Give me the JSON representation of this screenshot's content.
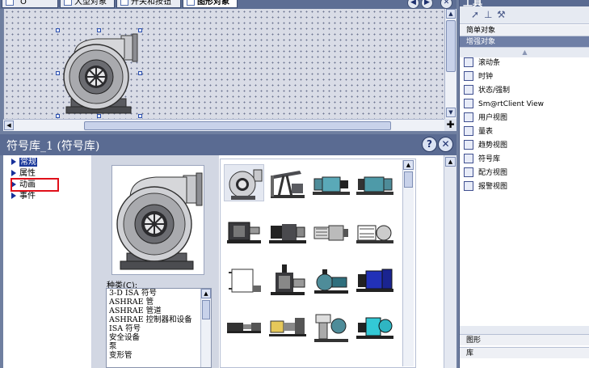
{
  "editor": {
    "tabs": [
      {
        "label": "ˆO"
      },
      {
        "label": "大型对象"
      },
      {
        "label": "开关和按钮"
      },
      {
        "label": "图形对象"
      }
    ],
    "nav_back": "◀",
    "nav_forward": "▶",
    "close": "✕",
    "corner_glyph": "✚"
  },
  "properties": {
    "title": "符号库_1 (符号库)",
    "help": "?",
    "close": "✕",
    "tree": [
      {
        "label": "常规",
        "selected": true
      },
      {
        "label": "属性",
        "selected": false
      },
      {
        "label": "动画",
        "selected": false,
        "highlighted": true
      },
      {
        "label": "事件",
        "selected": false
      }
    ],
    "category_label": "种类(C):",
    "categories": [
      "3-D ISA 符号",
      "ASHRAE 管",
      "ASHRAE 管道",
      "ASHRAE 控制器和设备",
      "ISA 符号",
      "安全设备",
      "泵",
      "变形管"
    ]
  },
  "tools": {
    "title": "工具",
    "icons": [
      "pointer-icon",
      "align-icon",
      "wrench-icon"
    ],
    "tabs": [
      {
        "label": "简单对象",
        "active": false
      },
      {
        "label": "增强对象",
        "active": true
      }
    ],
    "items": [
      {
        "label": "滚动条",
        "icon": "scrollbar-icon"
      },
      {
        "label": "时钟",
        "icon": "clock-icon"
      },
      {
        "label": "状态/强制",
        "icon": "status-force-icon"
      },
      {
        "label": "Sm@rtClient View",
        "icon": "smartclient-icon"
      },
      {
        "label": "用户视图",
        "icon": "user-view-icon"
      },
      {
        "label": "量表",
        "icon": "gauge-icon"
      },
      {
        "label": "趋势视图",
        "icon": "trend-view-icon"
      },
      {
        "label": "符号库",
        "icon": "symbol-library-icon"
      },
      {
        "label": "配方视图",
        "icon": "recipe-view-icon"
      },
      {
        "label": "报警视图",
        "icon": "alarm-view-icon"
      }
    ],
    "bottom_tabs": [
      "图形",
      "库"
    ]
  },
  "colors": {
    "accent": "#1c3a9b",
    "panel_header": "#5a6b92",
    "highlight_box": "#e0101a"
  }
}
